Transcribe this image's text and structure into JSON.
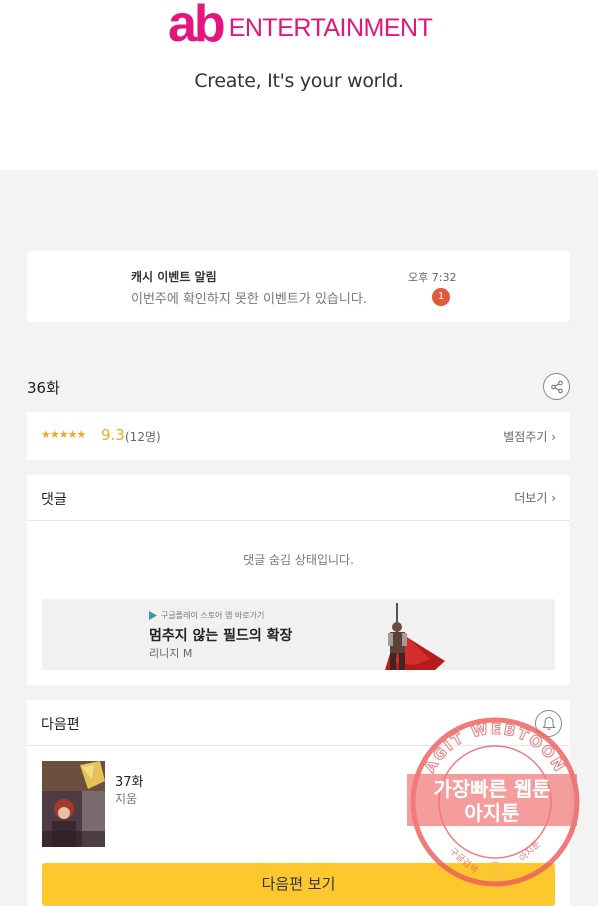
{
  "brand": {
    "logo_mark": "ab",
    "logo_text": "ENTERTAINMENT",
    "tagline": "Create, It's your world.",
    "color": "#e5157e"
  },
  "notification": {
    "title": "캐시 이벤트 알림",
    "body": "이번주에 확인하지 못한 이벤트가 있습니다.",
    "time": "오후 7:32",
    "badge": "1"
  },
  "episode": {
    "title": "36화",
    "share_icon": "share-icon"
  },
  "rating": {
    "stars": "★★★★★",
    "score": "9.3",
    "count": "(12명)",
    "rate_link": "별점주기 ›"
  },
  "comments": {
    "heading": "댓글",
    "more": "더보기 ›",
    "hidden_text": "댓글 숨김 상태입니다."
  },
  "ad": {
    "small_text": "구글플레이 스토어 앱 바로가기",
    "title": "멈추지 않는 필드의 확장",
    "subtitle": "리니지 M"
  },
  "next_episode": {
    "heading": "다음편",
    "episode": "37화",
    "status": "지움",
    "button": "다음편 보기",
    "button_color": "#fcc82e"
  },
  "watermark": {
    "arc_text": "AGIT WEBTOON",
    "line1": "가장빠른 웹툰",
    "line2": "아지툰",
    "bottom_left": "구글검색",
    "bottom_right": "아지툰",
    "color": "#ee5a5a"
  }
}
